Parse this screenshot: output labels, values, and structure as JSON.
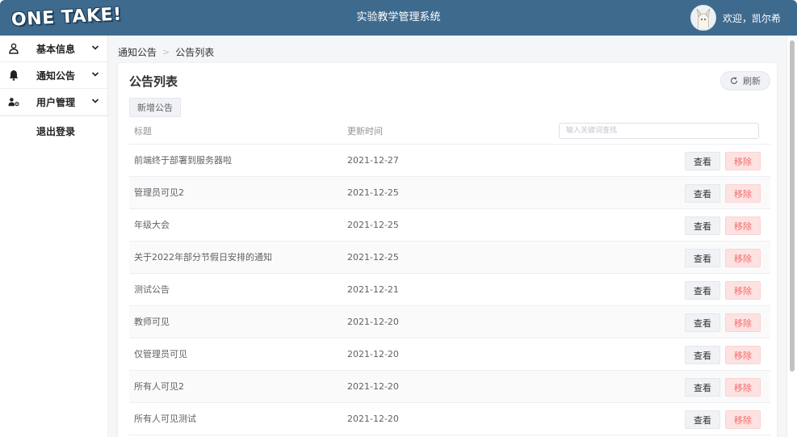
{
  "header": {
    "logo_text": "ONE TAKE!",
    "app_title": "实验教学管理系统",
    "welcome": "欢迎，凯尔希"
  },
  "sidebar": {
    "items": [
      {
        "label": "基本信息",
        "icon": "user-icon"
      },
      {
        "label": "通知公告",
        "icon": "bell-icon"
      },
      {
        "label": "用户管理",
        "icon": "user-cog-icon"
      }
    ],
    "logout": "退出登录"
  },
  "breadcrumb": {
    "parent": "通知公告",
    "separator": ">",
    "current": "公告列表"
  },
  "card": {
    "title": "公告列表",
    "refresh_label": "刷新",
    "add_label": "新增公告"
  },
  "table": {
    "headers": {
      "title": "标题",
      "time": "更新时间"
    },
    "search_placeholder": "输入关键词查找",
    "view_label": "查看",
    "remove_label": "移除",
    "rows": [
      {
        "title": "前端终于部署到服务器啦",
        "time": "2021-12-27"
      },
      {
        "title": "管理员可见2",
        "time": "2021-12-25"
      },
      {
        "title": "年级大会",
        "time": "2021-12-25"
      },
      {
        "title": "关于2022年部分节假日安排的通知",
        "time": "2021-12-25"
      },
      {
        "title": "测试公告",
        "time": "2021-12-21"
      },
      {
        "title": "教师可见",
        "time": "2021-12-20"
      },
      {
        "title": "仅管理员可见",
        "time": "2021-12-20"
      },
      {
        "title": "所有人可见2",
        "time": "2021-12-20"
      },
      {
        "title": "所有人可见测试",
        "time": "2021-12-20"
      }
    ]
  },
  "colors": {
    "header_bg": "#3e6a8e",
    "remove_text": "#f56c6c",
    "remove_bg": "#fde2e2"
  }
}
